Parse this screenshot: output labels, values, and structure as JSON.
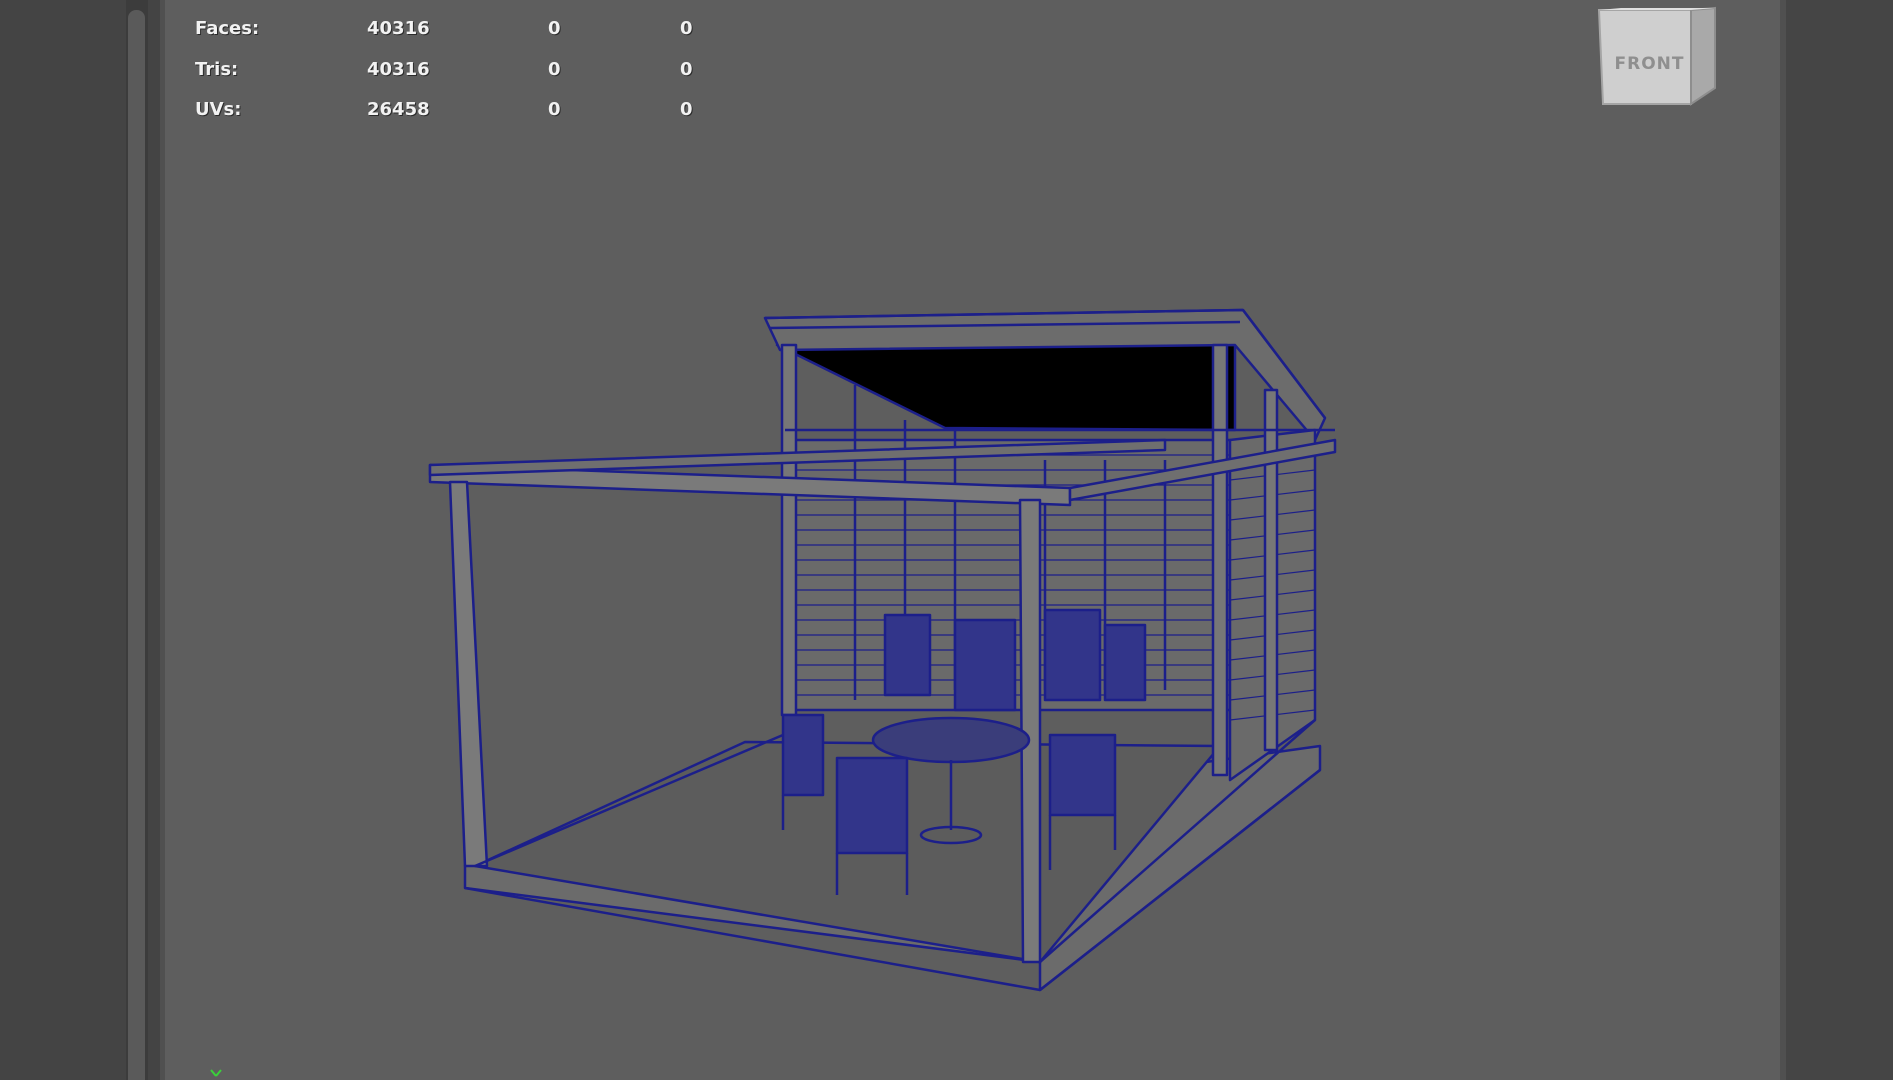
{
  "hud": {
    "rows": [
      {
        "label": "Faces:",
        "v1": "40316",
        "v2": "0",
        "v3": "0"
      },
      {
        "label": "Tris:",
        "v1": "40316",
        "v2": "0",
        "v3": "0"
      },
      {
        "label": "UVs:",
        "v1": "26458",
        "v2": "0",
        "v3": "0"
      }
    ]
  },
  "viewcube": {
    "label": "FRONT"
  },
  "colors": {
    "wireframe": "#1c1f8a",
    "viewport_bg": "#5e5e5e",
    "hud_text": "#f2f2f2"
  },
  "icons": {
    "viewcube": "viewcube-icon",
    "axis": "axis-gizmo-icon"
  }
}
